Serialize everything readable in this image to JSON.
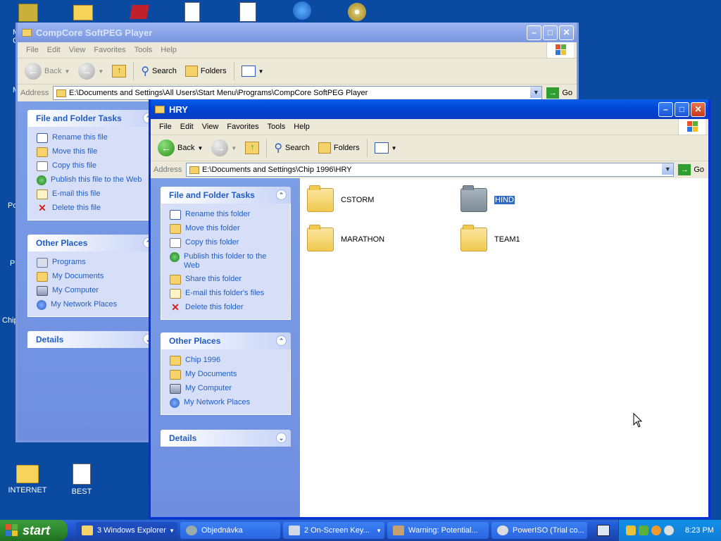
{
  "desktop": {
    "icons_bottom": [
      {
        "label": "INTERNET"
      },
      {
        "label": "BEST"
      }
    ],
    "partial_labels": [
      "M",
      "C",
      "M",
      "Po",
      "Pc",
      "Chip"
    ]
  },
  "back_window": {
    "title": "CompCore SoftPEG Player",
    "menu": [
      "File",
      "Edit",
      "View",
      "Favorites",
      "Tools",
      "Help"
    ],
    "toolbar": {
      "back": "Back",
      "search": "Search",
      "folders": "Folders"
    },
    "address_label": "Address",
    "address_value": "E:\\Documents and Settings\\All Users\\Start Menu\\Programs\\CompCore SoftPEG Player",
    "go_label": "Go",
    "tasks": {
      "title": "File and Folder Tasks",
      "items": [
        "Rename this file",
        "Move this file",
        "Copy this file",
        "Publish this file to the Web",
        "E-mail this file",
        "Delete this file"
      ]
    },
    "places": {
      "title": "Other Places",
      "items": [
        "Programs",
        "My Documents",
        "My Computer",
        "My Network Places"
      ]
    },
    "details": {
      "title": "Details"
    }
  },
  "front_window": {
    "title": "HRY",
    "menu": [
      "File",
      "Edit",
      "View",
      "Favorites",
      "Tools",
      "Help"
    ],
    "toolbar": {
      "back": "Back",
      "search": "Search",
      "folders": "Folders"
    },
    "address_label": "Address",
    "address_value": "E:\\Documents and Settings\\Chip 1996\\HRY",
    "go_label": "Go",
    "tasks": {
      "title": "File and Folder Tasks",
      "items": [
        "Rename this folder",
        "Move this folder",
        "Copy this folder",
        "Publish this folder to the Web",
        "Share this folder",
        "E-mail this folder's files",
        "Delete this folder"
      ]
    },
    "places": {
      "title": "Other Places",
      "items": [
        "Chip 1996",
        "My Documents",
        "My Computer",
        "My Network Places"
      ]
    },
    "details": {
      "title": "Details"
    },
    "folders": [
      {
        "name": "CSTORM",
        "selected": false
      },
      {
        "name": "HIND",
        "selected": true
      },
      {
        "name": "MARATHON",
        "selected": false
      },
      {
        "name": "TEAM1",
        "selected": false
      }
    ]
  },
  "taskbar": {
    "start": "start",
    "buttons": [
      "3 Windows Explorer",
      "Objednávka",
      "2 On-Screen Key...",
      "Warning: Potential...",
      "PowerISO (Trial co..."
    ],
    "clock": "8:23 PM"
  }
}
